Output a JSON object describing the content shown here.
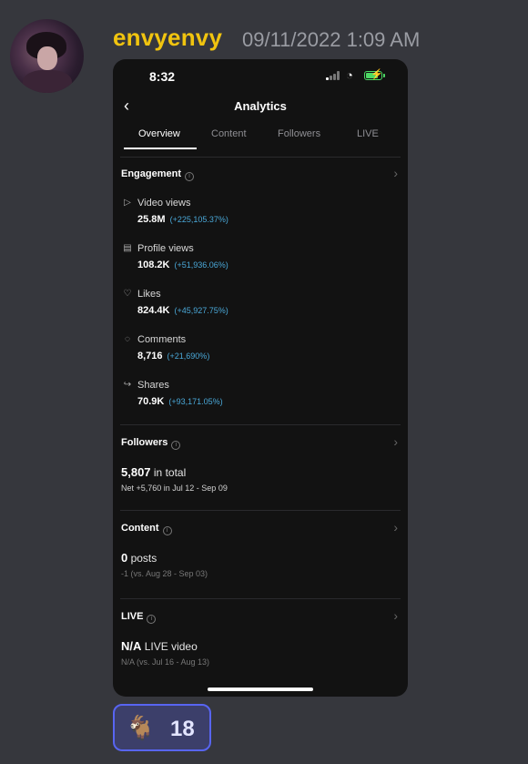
{
  "message": {
    "username": "envyenvy",
    "timestamp": "09/11/2022 1:09 AM",
    "username_color": "#f1c40f"
  },
  "phone": {
    "status_time": "8:32",
    "title": "Analytics",
    "tabs": [
      "Overview",
      "Content",
      "Followers",
      "LIVE"
    ],
    "active_tab": "Overview",
    "engagement": {
      "title": "Engagement",
      "metrics": [
        {
          "icon": "play-icon",
          "label": "Video views",
          "value": "25.8M",
          "change": "(+225,105.37%)"
        },
        {
          "icon": "profile-icon",
          "label": "Profile views",
          "value": "108.2K",
          "change": "(+51,936.06%)"
        },
        {
          "icon": "heart-icon",
          "label": "Likes",
          "value": "824.4K",
          "change": "(+45,927.75%)"
        },
        {
          "icon": "comment-icon",
          "label": "Comments",
          "value": "8,716",
          "change": "(+21,690%)"
        },
        {
          "icon": "share-icon",
          "label": "Shares",
          "value": "70.9K",
          "change": "(+93,171.05%)"
        }
      ]
    },
    "followers": {
      "title": "Followers",
      "count": "5,807",
      "count_suffix": "in total",
      "net": "Net +5,760 in Jul 12 - Sep 09"
    },
    "content": {
      "title": "Content",
      "count": "0",
      "count_suffix": "posts",
      "compare": "-1 (vs. Aug 28 - Sep 03)"
    },
    "live": {
      "title": "LIVE",
      "count": "N/A",
      "count_suffix": "LIVE video",
      "compare": "N/A (vs. Jul 16 - Aug 13)"
    },
    "change_color": "#4aa8d8"
  },
  "reaction": {
    "emoji": "🐐",
    "count": "18",
    "accent": "#5865f2"
  }
}
